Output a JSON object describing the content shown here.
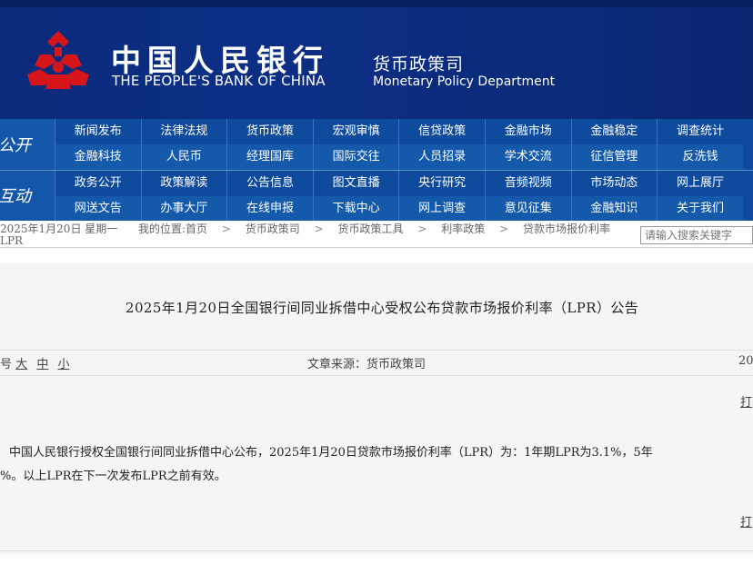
{
  "header": {
    "bank_cn": "中国人民银行",
    "bank_en": "THE PEOPLE'S BANK OF CHINA",
    "dept_cn": "货币政策司",
    "dept_en": "Monetary Policy Department",
    "colors": {
      "banner": "#0c2f86",
      "logo": "#d6161b",
      "nav": "#0e4b9c"
    }
  },
  "nav": {
    "section1": "公开",
    "section2": "互动",
    "row1": [
      "新闻发布",
      "法律法规",
      "货币政策",
      "宏观审慎",
      "信贷政策",
      "金融市场",
      "金融稳定",
      "调查统计"
    ],
    "row2": [
      "金融科技",
      "人民币",
      "经理国库",
      "国际交往",
      "人员招录",
      "学术交流",
      "征信管理",
      "反洗钱"
    ],
    "row3": [
      "政务公开",
      "政策解读",
      "公告信息",
      "图文直播",
      "央行研究",
      "音频视频",
      "市场动态",
      "网上展厅"
    ],
    "row4": [
      "网送文告",
      "办事大厅",
      "在线申报",
      "下载中心",
      "网上调查",
      "意见征集",
      "金融知识",
      "关于我们"
    ]
  },
  "info": {
    "date": "2025年1月20日  星期一",
    "location_label": "我的位置:首页",
    "crumbs": [
      "货币政策司",
      "货币政策工具",
      "利率政策",
      "贷款市场报价利率"
    ],
    "crumb_tail": "LPR",
    "search_placeholder": "请输入搜索关键字"
  },
  "article": {
    "title": "2025年1月20日全国银行间同业拆借中心受权公布贷款市场报价利率（LPR）公告",
    "font_label": "号",
    "font_sizes": [
      "大",
      "中",
      "小"
    ],
    "source": "文章来源：货币政策司",
    "meta_right": "20",
    "print": "打",
    "print_bottom": "打",
    "para_line1": "中国人民银行授权全国银行间同业拆借中心公布，2025年1月20日贷款市场报价利率（LPR）为：1年期LPR为3.1%，5年",
    "para_line2": "%。以上LPR在下一次发布LPR之前有效。"
  }
}
